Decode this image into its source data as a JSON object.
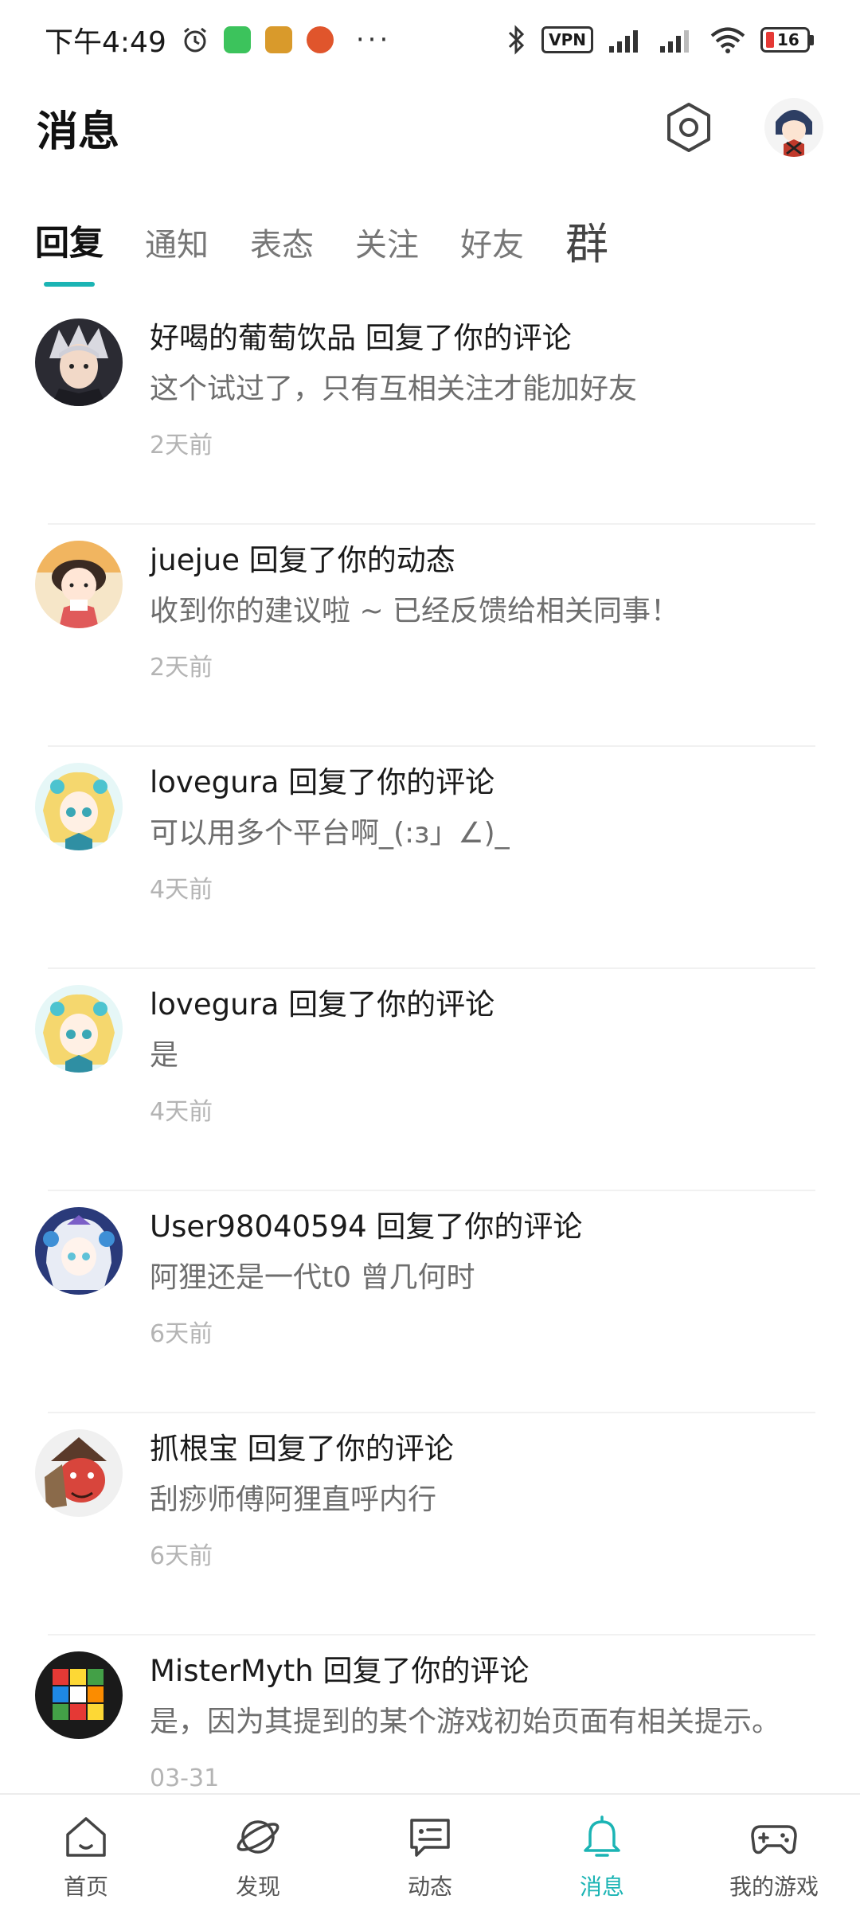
{
  "status_bar": {
    "time": "下午4:49",
    "vpn_label": "VPN",
    "battery_level": "16"
  },
  "header": {
    "title": "消息"
  },
  "tabs": [
    {
      "label": "回复",
      "active": true
    },
    {
      "label": "通知"
    },
    {
      "label": "表态"
    },
    {
      "label": "关注"
    },
    {
      "label": "好友"
    },
    {
      "label": "群"
    }
  ],
  "messages": [
    {
      "title": "好喝的葡萄饮品 回复了你的评论",
      "body": "这个试过了，只有互相关注才能加好友",
      "time": "2天前",
      "avatar": "avatar-white-hair"
    },
    {
      "title": "juejue 回复了你的动态",
      "body": "收到你的建议啦 ~ 已经反馈给相关同事！",
      "time": "2天前",
      "avatar": "avatar-cartoon-girl"
    },
    {
      "title": "lovegura 回复了你的评论",
      "body": "可以用多个平台啊_(:з」∠)_",
      "time": "4天前",
      "avatar": "avatar-blonde-anime"
    },
    {
      "title": "lovegura 回复了你的评论",
      "body": "是",
      "time": "4天前",
      "avatar": "avatar-blonde-anime"
    },
    {
      "title": "User98040594 回复了你的评论",
      "body": "阿狸还是一代t0  曾几何时",
      "time": "6天前",
      "avatar": "avatar-silver-anime"
    },
    {
      "title": "抓根宝 回复了你的评论",
      "body": "刮痧师傅阿狸直呼内行",
      "time": "6天前",
      "avatar": "avatar-red-mask"
    },
    {
      "title": "MisterMyth 回复了你的评论",
      "body": "是，因为其提到的某个游戏初始页面有相关提示。",
      "time": "03-31",
      "avatar": "avatar-rubiks-cube"
    }
  ],
  "bottom_nav": [
    {
      "label": "首页",
      "icon": "home-icon"
    },
    {
      "label": "发现",
      "icon": "discover-icon"
    },
    {
      "label": "动态",
      "icon": "feed-icon"
    },
    {
      "label": "消息",
      "icon": "bell-icon",
      "active": true
    },
    {
      "label": "我的游戏",
      "icon": "gamepad-icon"
    }
  ],
  "colors": {
    "accent": "#1bb4b4",
    "text_primary": "#1a1a1a",
    "text_secondary": "#6e6e6e",
    "text_muted": "#b4b4b4"
  }
}
